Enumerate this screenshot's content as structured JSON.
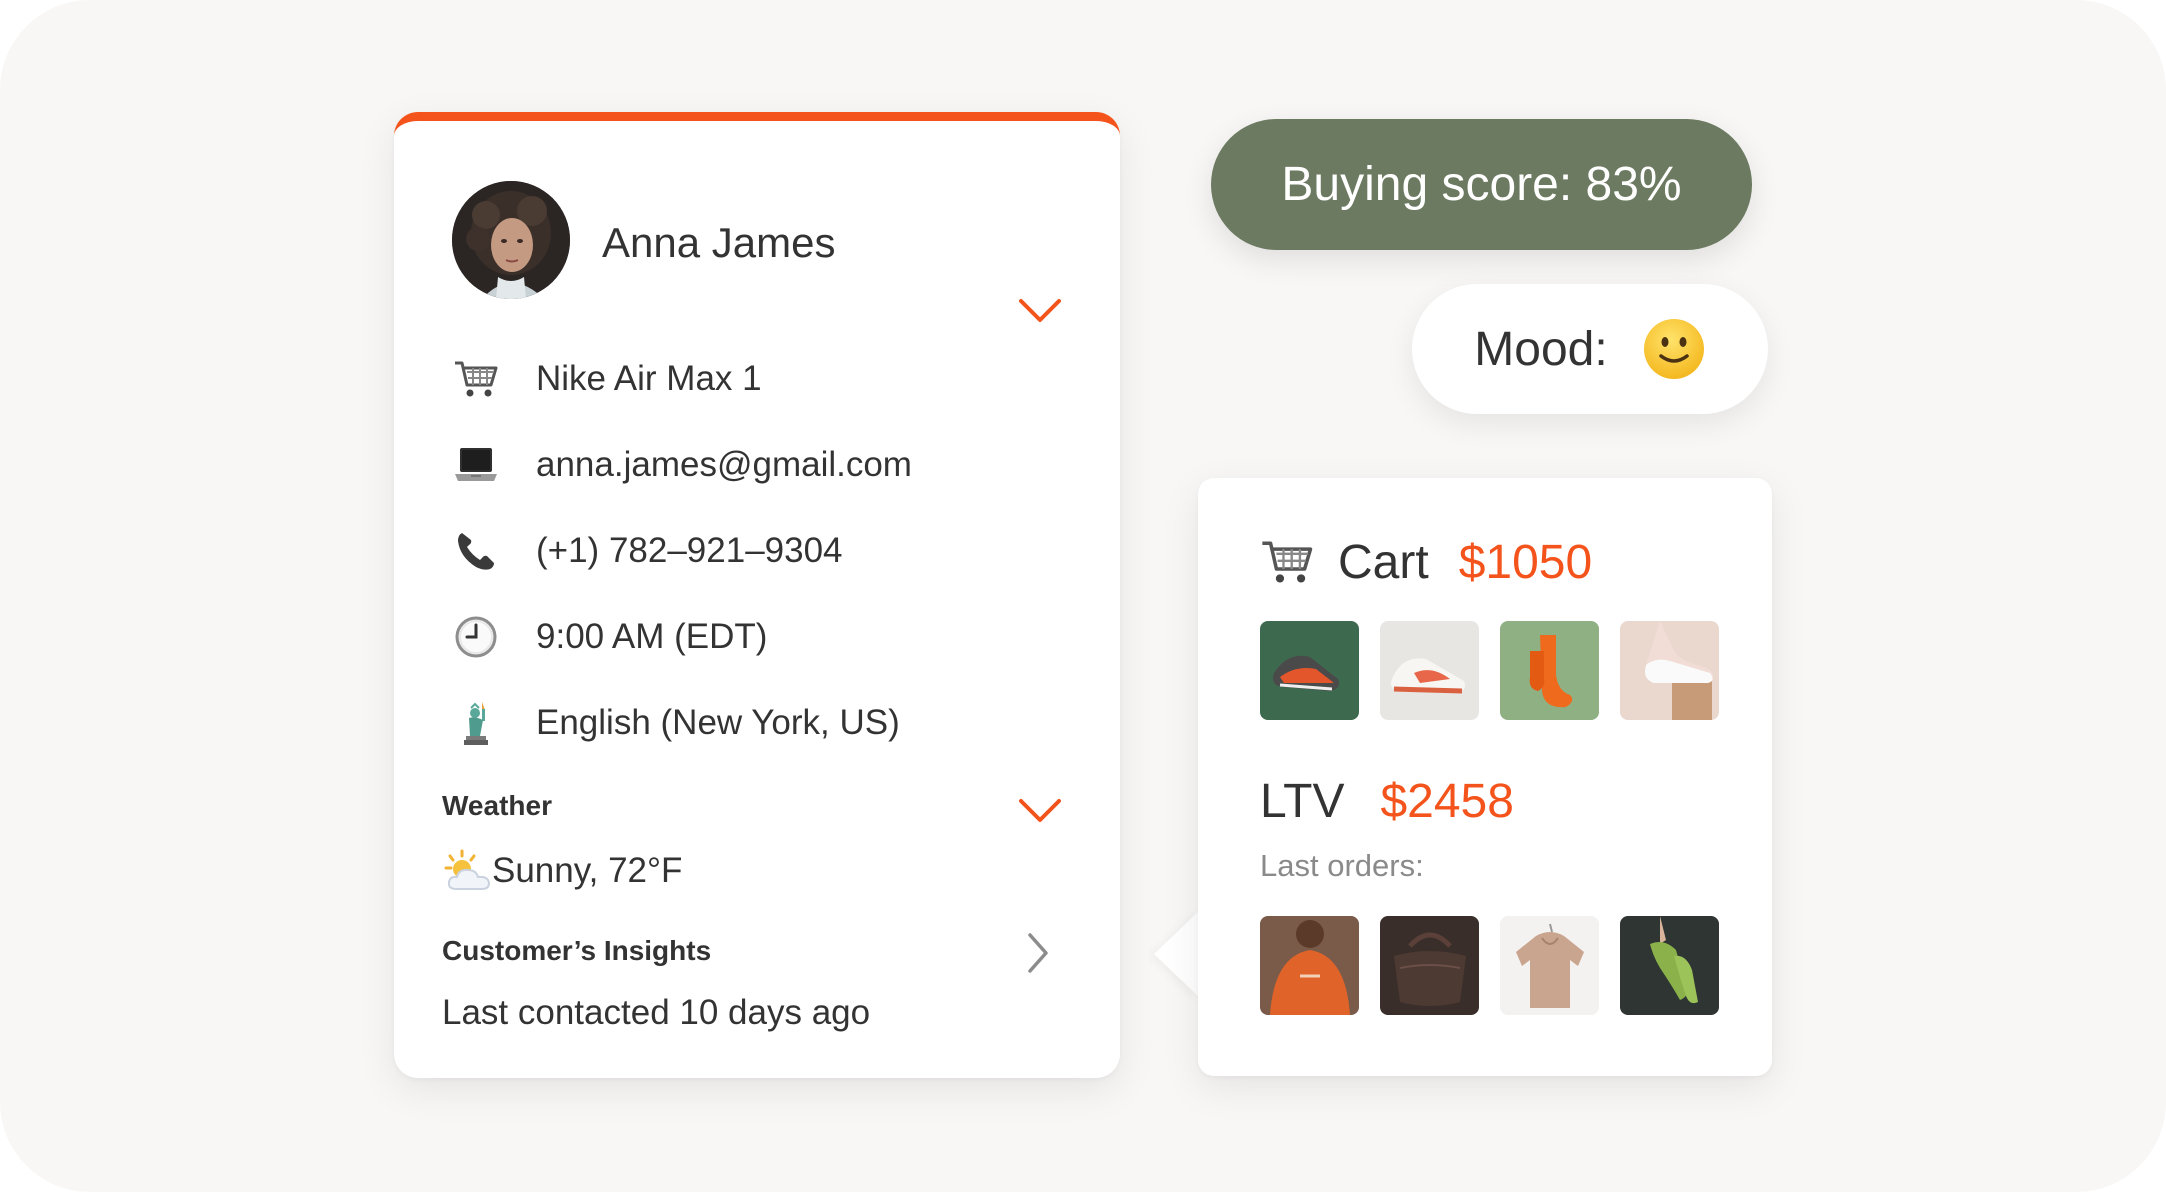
{
  "customer": {
    "name": "Anna James",
    "product": "Nike Air Max 1",
    "email": "anna.james@gmail.com",
    "phone": "(+1) 782–921–9304",
    "time": "9:00 AM (EDT)",
    "language": "English (New York, US)",
    "weather_label": "Weather",
    "weather": "Sunny, 72°F",
    "insights_label": "Customer’s Insights",
    "last_contacted": "Last contacted 10 days ago"
  },
  "score": {
    "text": "Buying score: 83%"
  },
  "mood": {
    "label": "Mood:"
  },
  "cart": {
    "label": "Cart",
    "amount": "$1050",
    "ltv_label": "LTV",
    "ltv_amount": "$2458",
    "last_orders_label": "Last orders:"
  },
  "icons": {
    "product": "cart-icon",
    "email": "laptop-icon",
    "phone": "phone-icon",
    "time": "clock-icon",
    "language": "statue-of-liberty-icon",
    "weather": "sun-behind-cloud-icon",
    "mood": "slightly-smiling-face-icon"
  },
  "colors": {
    "accent": "#f4541c",
    "score_pill": "#6b7a60"
  }
}
